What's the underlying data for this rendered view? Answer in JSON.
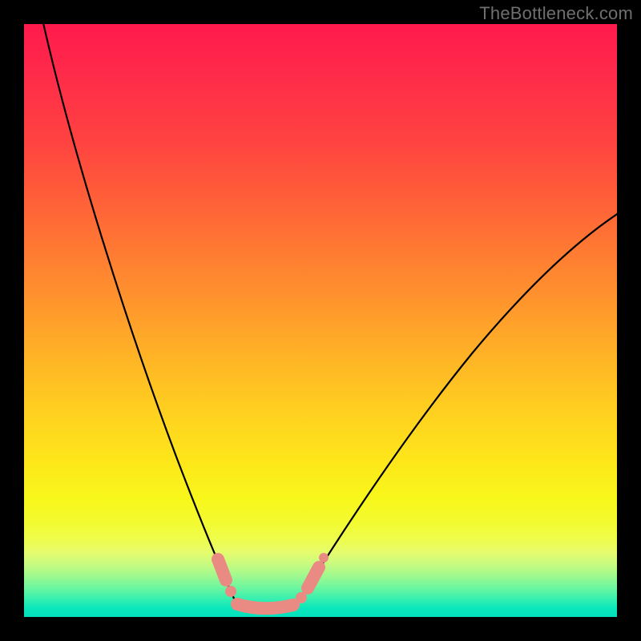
{
  "watermark": "TheBottleneck.com",
  "colors": {
    "frame_bg": "#000000",
    "watermark_text": "#6f6f6f",
    "curve_stroke": "#000000",
    "marker_fill": "#e98b83",
    "gradient_top": "#ff1a4c",
    "gradient_bottom": "#03dfbc"
  },
  "chart_data": {
    "type": "line",
    "title": "",
    "xlabel": "",
    "ylabel": "",
    "xlim": [
      0,
      100
    ],
    "ylim": [
      0,
      100
    ],
    "grid": false,
    "note": "V-shaped bottleneck curve over a vertical red→yellow→green gradient. Y is a mismatch/bottleneck percentage (100 = top/red, 0 = bottom/green). X is a configuration sweep (arbitrary 0–100). Two curve arms meet in a flat valley around x≈36–46. Values estimated from pixel positions.",
    "series": [
      {
        "name": "left-arm",
        "x": [
          3,
          6,
          10,
          14,
          18,
          22,
          25,
          28,
          30,
          32,
          34,
          36
        ],
        "y": [
          100,
          88,
          74,
          60,
          48,
          37,
          29,
          21,
          15,
          10,
          5,
          1
        ]
      },
      {
        "name": "valley-floor",
        "x": [
          36,
          38,
          40,
          42,
          44,
          46
        ],
        "y": [
          1,
          0.5,
          0.5,
          0.5,
          0.5,
          1
        ]
      },
      {
        "name": "right-arm",
        "x": [
          46,
          49,
          53,
          58,
          64,
          72,
          80,
          88,
          95,
          100
        ],
        "y": [
          1,
          6,
          12,
          20,
          29,
          40,
          50,
          58,
          64,
          68
        ]
      }
    ],
    "markers": {
      "name": "highlighted-range-beads",
      "color": "#e98b83",
      "points": [
        {
          "x": 33,
          "y": 8
        },
        {
          "x": 34,
          "y": 5
        },
        {
          "x": 36,
          "y": 1.5
        },
        {
          "x": 38,
          "y": 0.8
        },
        {
          "x": 40,
          "y": 0.6
        },
        {
          "x": 42,
          "y": 0.6
        },
        {
          "x": 44,
          "y": 0.8
        },
        {
          "x": 46,
          "y": 1.5
        },
        {
          "x": 48,
          "y": 4
        },
        {
          "x": 49.5,
          "y": 7
        },
        {
          "x": 50.5,
          "y": 9
        }
      ]
    }
  }
}
